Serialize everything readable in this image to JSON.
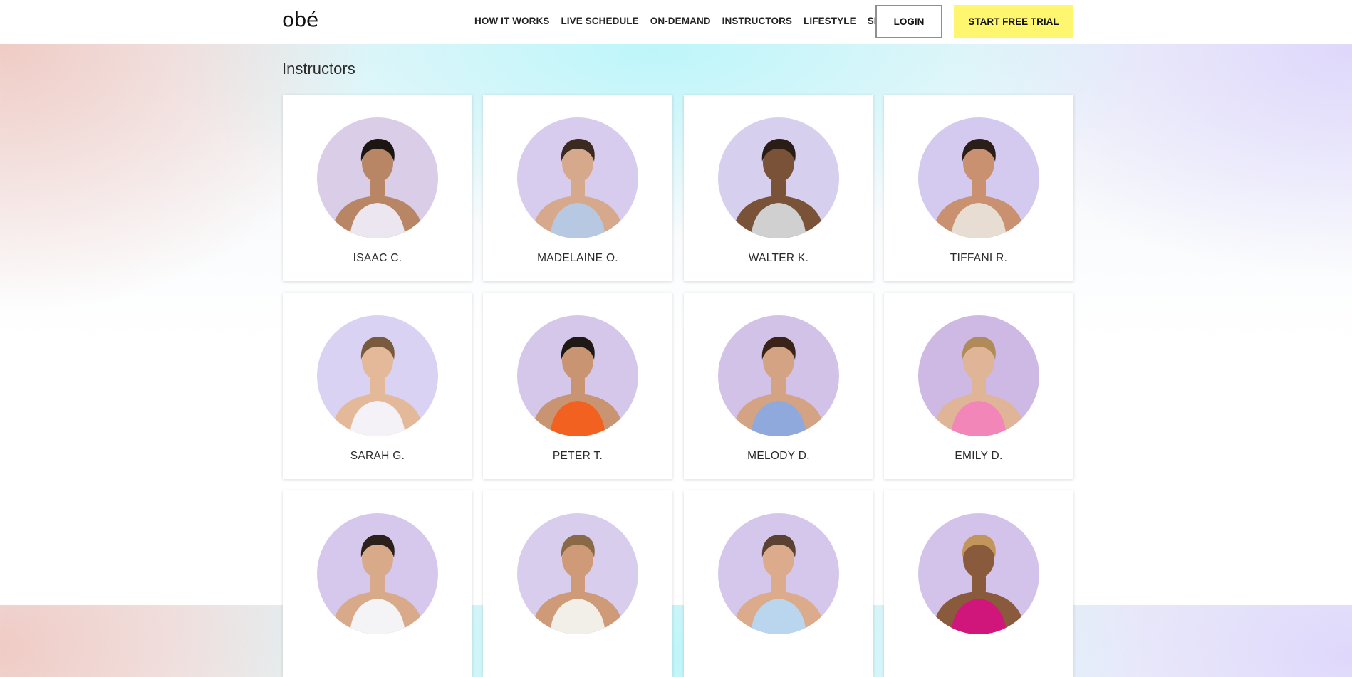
{
  "brand": {
    "logo_text": "obé"
  },
  "nav": {
    "items": [
      {
        "label": "HOW IT WORKS"
      },
      {
        "label": "LIVE SCHEDULE"
      },
      {
        "label": "ON-DEMAND"
      },
      {
        "label": "INSTRUCTORS"
      },
      {
        "label": "LIFESTYLE"
      },
      {
        "label": "SHOP"
      }
    ],
    "login_label": "LOGIN",
    "trial_label": "START FREE TRIAL"
  },
  "colors": {
    "trial_button": "#fdf66e",
    "avatar_lavender": "#d8c9ec"
  },
  "page": {
    "title": "Instructors"
  },
  "instructors": [
    {
      "name": "ISAAC C.",
      "skin": "#b98665",
      "hair": "#1c1612",
      "outfit": "#ece6f0",
      "bg": "#d9cde8"
    },
    {
      "name": "MADELAINE O.",
      "skin": "#d7a98c",
      "hair": "#3b2a20",
      "outfit": "#b7c9e2",
      "bg": "#d8ccee"
    },
    {
      "name": "WALTER K.",
      "skin": "#7a5238",
      "hair": "#2a1d15",
      "outfit": "#cfd0cf",
      "bg": "#d6cfee"
    },
    {
      "name": "TIFFANI R.",
      "skin": "#c99170",
      "hair": "#2b1e18",
      "outfit": "#e8ddd3",
      "bg": "#d4c9ee"
    },
    {
      "name": "SARAH G.",
      "skin": "#e3b99a",
      "hair": "#7a5a3c",
      "outfit": "#f4f2f6",
      "bg": "#d9d2f2"
    },
    {
      "name": "PETER T.",
      "skin": "#c89472",
      "hair": "#1e1915",
      "outfit": "#f2611f",
      "bg": "#d5c7ea"
    },
    {
      "name": "MELODY D.",
      "skin": "#d3a384",
      "hair": "#3a2418",
      "outfit": "#8fa9dc",
      "bg": "#d2c2e8"
    },
    {
      "name": "EMILY D.",
      "skin": "#dfb497",
      "hair": "#b08a58",
      "outfit": "#f286b8",
      "bg": "#cdb9e4"
    },
    {
      "name": "",
      "skin": "#d9aa8a",
      "hair": "#2c211a",
      "outfit": "#f4f4f6",
      "bg": "#d6c7ec"
    },
    {
      "name": "",
      "skin": "#cf9a78",
      "hair": "#8a6a46",
      "outfit": "#f2efe9",
      "bg": "#d9cdee"
    },
    {
      "name": "",
      "skin": "#dcab8b",
      "hair": "#5b4131",
      "outfit": "#b9d6ee",
      "bg": "#d5c6ec"
    },
    {
      "name": "",
      "skin": "#8a5a3d",
      "hair": "#c2955a",
      "outfit": "#d0167a",
      "bg": "#d3c3ea"
    }
  ]
}
